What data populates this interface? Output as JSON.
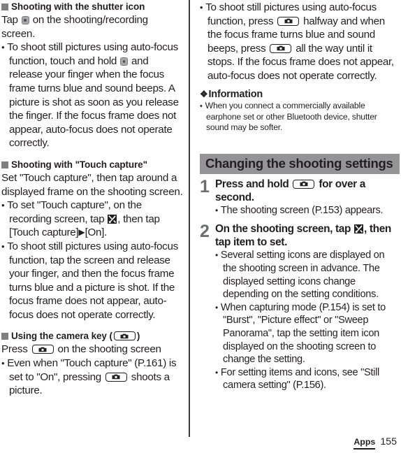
{
  "page": {
    "number": "155",
    "tab_label": "Apps"
  },
  "left_column": {
    "section1": {
      "heading": "Shooting with the shutter icon",
      "intro_before_icon": "Tap",
      "intro_after_icon": "on the shooting/recording screen.",
      "bullet1_part1": "To shoot still pictures using auto-focus function, touch and hold",
      "bullet1_part2": "and release your finger when the focus frame turns blue and sound beeps. A picture is shot as soon as you release the finger. If the focus frame does not appear, auto-focus does not operate correctly."
    },
    "section2": {
      "heading": "Shooting with \"Touch capture\"",
      "intro": "Set \"Touch capture\", then tap around a displayed frame on the shooting screen.",
      "bullet1_part1": "To set \"Touch capture\", on the recording screen, tap",
      "bullet1_part2": ", then tap [Touch capture]",
      "bullet1_arrow": "▶",
      "bullet1_part3": "[On].",
      "bullet2": "To shoot still pictures using auto-focus function, tap the screen and release your finger, and then the focus frame turns blue and a picture is shot. If the focus frame does not appear, auto-focus does not operate correctly."
    },
    "section3": {
      "heading_part1": "Using the camera key (",
      "heading_part2": ")",
      "intro_part1": "Press",
      "intro_part2": "on the shooting screen",
      "bullet1_part1": "Even when \"Touch capture\" (P.161) is set to \"On\", pressing",
      "bullet1_part2": "shoots a picture."
    }
  },
  "right_column": {
    "bullet_top_part1": "To shoot still pictures using auto-focus function, press",
    "bullet_top_part2": "halfway and when the focus frame turns blue and sound beeps, press",
    "bullet_top_part3": "all the way until it stops. If the focus frame does not appear, auto-focus does not operate correctly.",
    "information": {
      "marker": "❖",
      "heading": "Information",
      "bullet1": "When you connect a commercially available earphone set or other Bluetooth device, shutter sound may be softer."
    },
    "banner": "Changing the shooting settings",
    "steps": [
      {
        "number": "1",
        "title_part1": "Press and hold",
        "title_part2": "for over a second.",
        "bullets": [
          "The shooting screen (P.153) appears."
        ]
      },
      {
        "number": "2",
        "title_part1": "On the shooting screen, tap",
        "title_part2": ", then tap item to set.",
        "bullets": [
          "Several setting icons are displayed on the shooting screen in advance. The displayed setting icons change depending on the setting conditions.",
          "When capturing mode (P.154) is set to \"Burst\", \"Picture effect\" or \"Sweep Panorama\", tap the setting item icon displayed on the shooting screen to change the setting.",
          "For setting items and icons, see \"Still camera setting\" (P.156)."
        ]
      }
    ]
  }
}
